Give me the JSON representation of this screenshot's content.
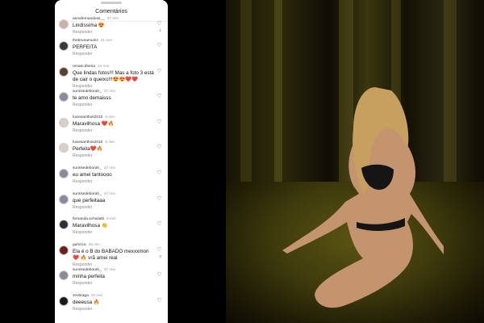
{
  "header": {
    "title": "Comentários"
  },
  "reply_label": "Responder",
  "comments": [
    {
      "user": "annafernandess__",
      "time": "37 min",
      "text": "Lindíssima 😍",
      "likes": "1",
      "avatar": "#c9b4a8"
    },
    {
      "user": "thebrunamuniz",
      "time": "31 min",
      "text": "PERFEITA",
      "likes": "",
      "avatar": "#3a3a3a"
    },
    {
      "user": "renato.tiberia",
      "time": "24 min",
      "text": "Que lindas fotos!!! Mas a foto 3 está de cair o queixo!!!😍😍❤️❤️",
      "likes": "",
      "avatar": "#5a4030"
    },
    {
      "user": "sunrisedeborah_",
      "time": "37 min",
      "text": "te amo demaisss",
      "likes": "",
      "avatar": "#8a8a9a"
    },
    {
      "user": "luciesanthos2010",
      "time": "6 min",
      "text": "Maravilhosa ❤️🔥",
      "likes": "",
      "avatar": "#d8cfc8"
    },
    {
      "user": "luciesanthos2010",
      "time": "6 min",
      "text": "Perfeita❤️🔥",
      "likes": "",
      "avatar": "#d8cfc8"
    },
    {
      "user": "sunrisedeborah_",
      "time": "37 min",
      "text": "eu amei tantoooo",
      "likes": "",
      "avatar": "#8a8a9a"
    },
    {
      "user": "sunrisedeborah_",
      "time": "37 min",
      "text": "que perfeitaaa",
      "likes": "",
      "avatar": "#8a8a9a"
    },
    {
      "user": "fernanda.schiolatti",
      "time": "9 min",
      "text": "Maravilhosa 👏",
      "likes": "",
      "avatar": "#2a3038"
    },
    {
      "user": "guhcica",
      "time": "38 min",
      "text": "Ela é o B do BABADO mexxxmon ❤️ 🔥 vrã amei real",
      "likes": "2",
      "avatar": "#6a2018"
    },
    {
      "user": "sunrisedeborah_",
      "time": "37 min",
      "text": "minha perfeita",
      "likes": "",
      "avatar": "#8a8a9a"
    },
    {
      "user": "zevbraga",
      "time": "32 min",
      "text": "deeeusa 🔥",
      "likes": "",
      "avatar": "#1a1a1a"
    }
  ],
  "icons": {
    "like": "heart-outline-icon"
  },
  "colors": {
    "panel_bg": "#ffffff",
    "page_bg": "#000000",
    "photo_tone": "#3e3a0d"
  }
}
